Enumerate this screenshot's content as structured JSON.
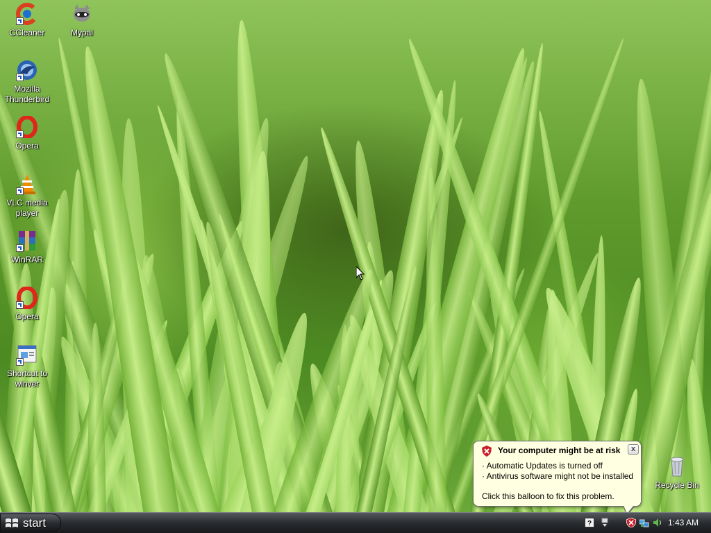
{
  "desktop": {
    "wallpaper": "green grass blades",
    "icons": [
      {
        "label": "CCleaner",
        "icon": "ccleaner-icon",
        "color": "#d94020"
      },
      {
        "label": "Mypal",
        "icon": "mypal-icon",
        "color": "#6a6a6a"
      },
      {
        "label": "Mozilla Thunderbird",
        "icon": "thunderbird-icon",
        "color": "#2a63b5"
      },
      {
        "label": "Opera",
        "icon": "opera-icon",
        "color": "#e0251b"
      },
      {
        "label": "VLC media player",
        "icon": "vlc-icon",
        "color": "#f08a00"
      },
      {
        "label": "WinRAR",
        "icon": "winrar-icon",
        "color": "#7a2b8f"
      },
      {
        "label": "Opera",
        "icon": "opera-icon",
        "color": "#e0251b"
      },
      {
        "label": "Shortcut to winver",
        "icon": "winver-icon",
        "color": "#3a6fc4"
      },
      {
        "label": "Recycle Bin",
        "icon": "recycle-bin-icon",
        "color": "#b0b6bd"
      }
    ]
  },
  "balloon": {
    "title": "Your computer might be at risk",
    "lines": [
      "· Automatic Updates is turned off",
      "· Antivirus software might not be installed"
    ],
    "footer": "Click this balloon to fix this problem.",
    "close_label": "x",
    "icon": "security-shield-icon",
    "background": "#ffffe1"
  },
  "taskbar": {
    "start_label": "start",
    "tray_icons": [
      "help-icon",
      "safely-remove-icon",
      "security-alert-icon",
      "network-icon",
      "volume-icon"
    ],
    "clock": "1:43 AM"
  }
}
